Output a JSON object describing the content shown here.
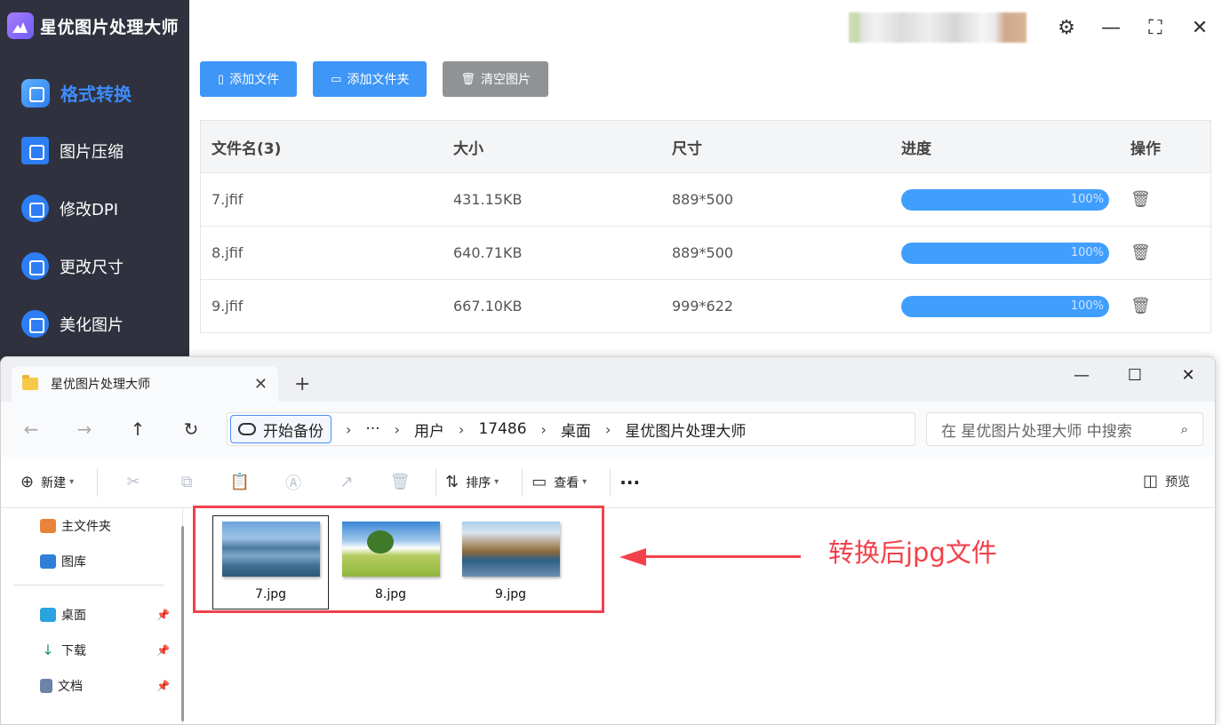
{
  "app": {
    "title": "星优图片处理大师",
    "nav": [
      {
        "label": "格式转换",
        "icon": "image-convert-icon",
        "active": true
      },
      {
        "label": "图片压缩",
        "icon": "image-compress-icon"
      },
      {
        "label": "修改DPI",
        "icon": "dpi-icon"
      },
      {
        "label": "更改尺寸",
        "icon": "resize-icon"
      },
      {
        "label": "美化图片",
        "icon": "beautify-icon"
      }
    ],
    "window_controls": {
      "settings": "⚙",
      "minimize": "—",
      "maximize": "⛶",
      "close": "✕"
    },
    "toolbar": {
      "add_file": "添加文件",
      "add_folder": "添加文件夹",
      "clear": "清空图片"
    },
    "table": {
      "headers": [
        "文件名(3)",
        "大小",
        "尺寸",
        "进度",
        "操作"
      ],
      "rows": [
        {
          "name": "7.jfif",
          "size": "431.15KB",
          "dims": "889*500",
          "progress": "100%",
          "progress_value": 100
        },
        {
          "name": "8.jfif",
          "size": "640.71KB",
          "dims": "889*500",
          "progress": "100%",
          "progress_value": 100
        },
        {
          "name": "9.jfif",
          "size": "667.10KB",
          "dims": "999*622",
          "progress": "100%",
          "progress_value": 100
        }
      ]
    },
    "colors": {
      "accent": "#3e96f7",
      "sidebar": "#2f323e",
      "progress": "#409eff"
    }
  },
  "explorer": {
    "tab_title": "星优图片处理大师",
    "new_tab": "+",
    "address": {
      "backup": "开始备份",
      "more": "···",
      "crumbs": [
        "用户",
        "17486",
        "桌面",
        "星优图片处理大师"
      ]
    },
    "search_placeholder": "在 星优图片处理大师 中搜索",
    "commands": {
      "new": "新建",
      "sort": "排序",
      "view": "查看",
      "more": "···",
      "preview": "预览"
    },
    "nav": [
      {
        "label": "主文件夹",
        "icon": "home-icon"
      },
      {
        "label": "图库",
        "icon": "gallery-icon"
      },
      {
        "label": "桌面",
        "icon": "desktop-icon",
        "pinned": true
      },
      {
        "label": "下载",
        "icon": "download-icon",
        "pinned": true
      },
      {
        "label": "文档",
        "icon": "document-icon",
        "pinned": true
      }
    ],
    "files": [
      {
        "name": "7.jpg",
        "selected": true
      },
      {
        "name": "8.jpg",
        "selected": false
      },
      {
        "name": "9.jpg",
        "selected": false
      }
    ]
  },
  "annotation": {
    "text": "转换后jpg文件",
    "color": "#f1424b"
  }
}
